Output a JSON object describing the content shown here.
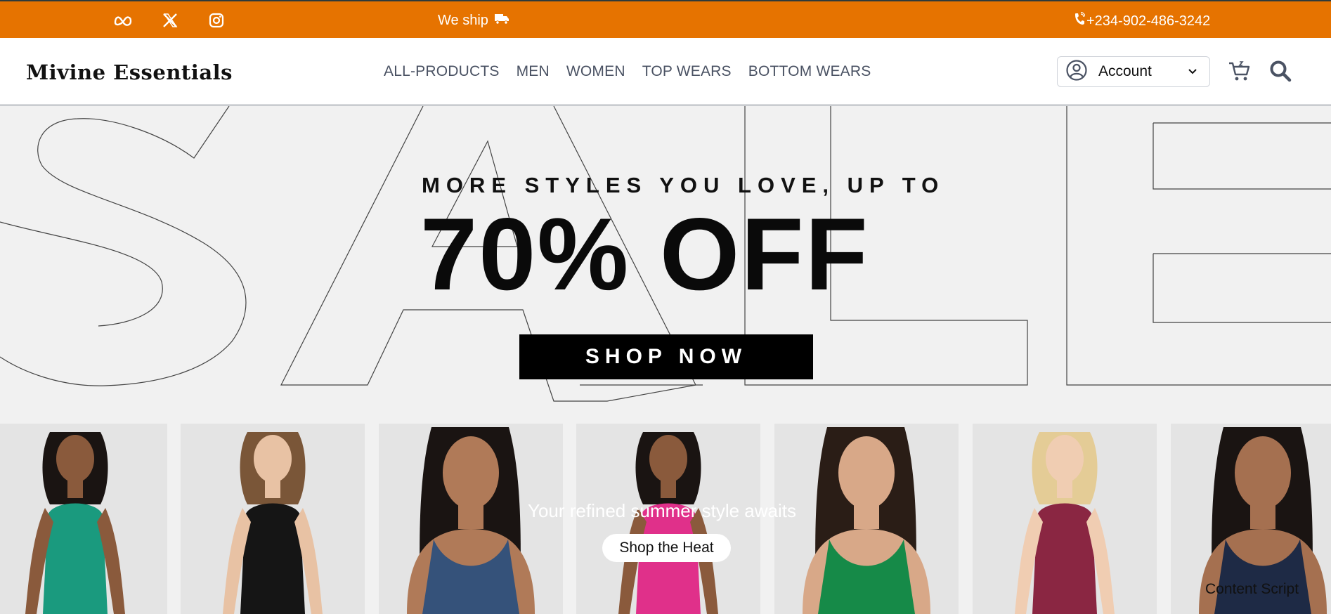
{
  "topbar": {
    "social": [
      {
        "name": "meta-icon"
      },
      {
        "name": "x-twitter-icon"
      },
      {
        "name": "instagram-icon"
      }
    ],
    "ship_text": "We ship",
    "phone": "+234-902-486-3242"
  },
  "nav": {
    "logo": "Mivine Essentials",
    "menu": [
      "ALL-PRODUCTS",
      "MEN",
      "WOMEN",
      "TOP WEARS",
      "BOTTOM WEARS"
    ],
    "account_label": "Account"
  },
  "hero": {
    "small_headline": "MORE STYLES YOU LOVE, UP TO",
    "big_headline": "70% OFF",
    "cta": "SHOP NOW",
    "tagline": "Your refined summer style awaits",
    "secondary_cta": "Shop the Heat",
    "overlay_text": "Content Script"
  },
  "models": [
    {
      "outfit_color": "#1a9a7e",
      "skin": "#8a5a3c",
      "hair": "#1a1412"
    },
    {
      "outfit_color": "#151515",
      "skin": "#e8c2a4",
      "hair": "#7a5638"
    },
    {
      "outfit_color": "#35527a",
      "skin": "#b07a58",
      "hair": "#1a1412"
    },
    {
      "outfit_color": "#e0308a",
      "skin": "#8a5a3c",
      "hair": "#1a1412"
    },
    {
      "outfit_color": "#168a48",
      "skin": "#d8a888",
      "hair": "#2a1d16"
    },
    {
      "outfit_color": "#8a2642",
      "skin": "#f0cdb2",
      "hair": "#e4cc96"
    },
    {
      "outfit_color": "#1e2a45",
      "skin": "#a57050",
      "hair": "#1a1412"
    }
  ],
  "colors": {
    "topbar": "#e67300",
    "hero_bg": "#f1f1f1",
    "nav_text": "#4a5263"
  }
}
